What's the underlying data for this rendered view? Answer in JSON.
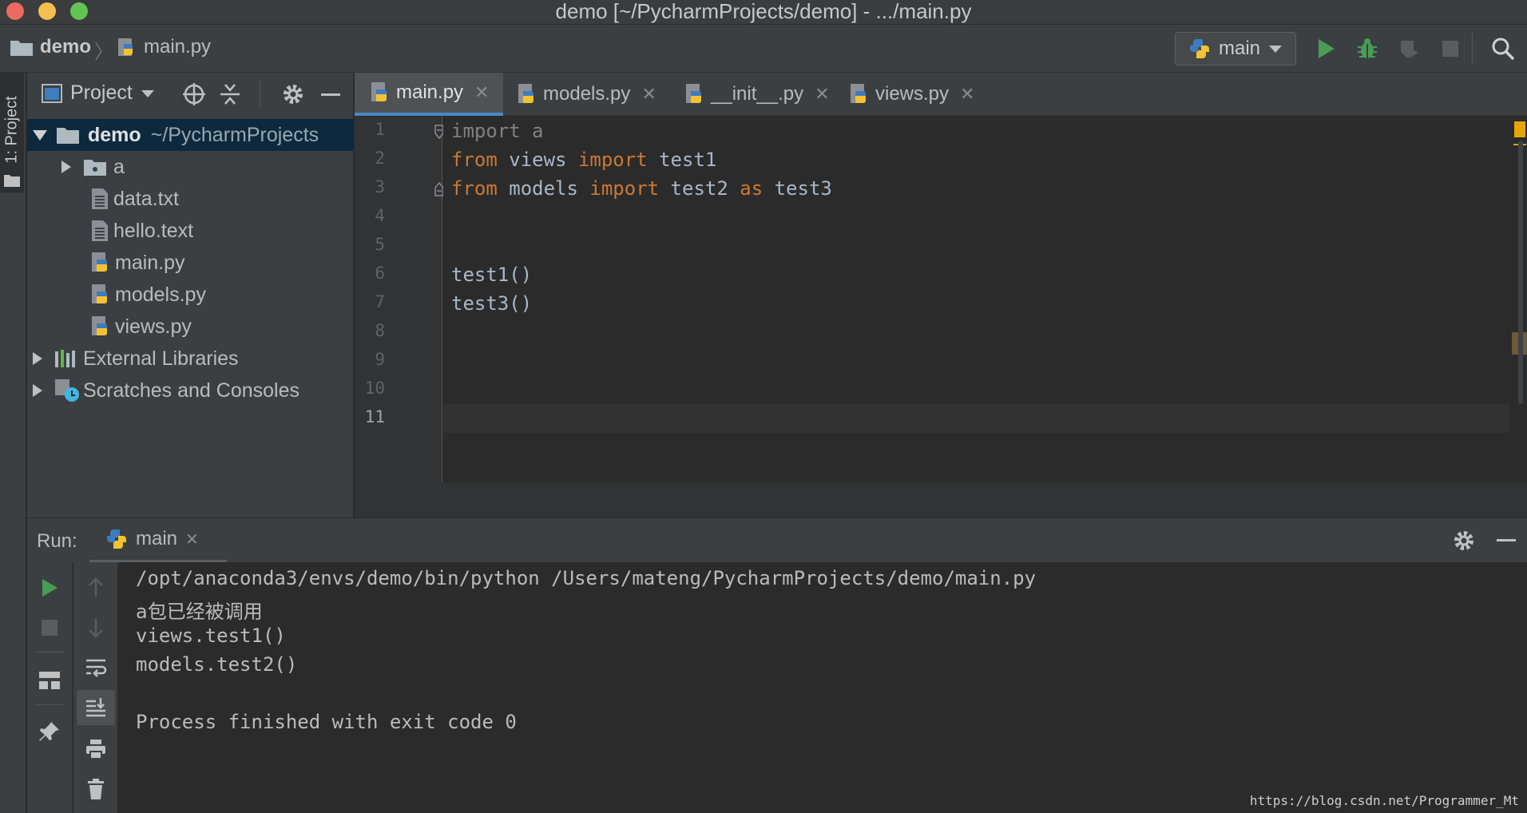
{
  "window": {
    "title": "demo [~/PycharmProjects/demo] - .../main.py"
  },
  "navbar": {
    "breadcrumb_project": "demo",
    "breadcrumb_file": "main.py",
    "run_config": "main"
  },
  "stripe": {
    "project_tab_label": "1: Project"
  },
  "project_panel": {
    "view_selector": "Project",
    "tree": [
      {
        "label": "demo",
        "hint": "~/PycharmProjects",
        "type": "folder-root"
      },
      {
        "label": "a",
        "type": "package"
      },
      {
        "label": "data.txt",
        "type": "text"
      },
      {
        "label": "hello.text",
        "type": "text"
      },
      {
        "label": "main.py",
        "type": "python"
      },
      {
        "label": "models.py",
        "type": "python"
      },
      {
        "label": "views.py",
        "type": "python"
      },
      {
        "label": "External Libraries",
        "type": "libraries"
      },
      {
        "label": "Scratches and Consoles",
        "type": "scratches"
      }
    ]
  },
  "editor": {
    "tabs": [
      {
        "label": "main.py",
        "active": true
      },
      {
        "label": "models.py"
      },
      {
        "label": "__init__.py"
      },
      {
        "label": "views.py"
      }
    ],
    "line_numbers": [
      "1",
      "2",
      "3",
      "4",
      "5",
      "6",
      "7",
      "8",
      "9",
      "10",
      "11"
    ],
    "code": {
      "l1_kw": "import",
      "l1_rest": " a",
      "l2_kw1": "from",
      "l2_mod": " views ",
      "l2_kw2": "import",
      "l2_name": " test1",
      "l3_kw1": "from",
      "l3_mod": " models ",
      "l3_kw2": "import",
      "l3_name": " test2 ",
      "l3_kw3": "as",
      "l3_alias": " test3",
      "l6": "test1()",
      "l7": "test3()"
    }
  },
  "run_panel": {
    "label": "Run:",
    "tab": "main",
    "output": [
      "/opt/anaconda3/envs/demo/bin/python /Users/mateng/PycharmProjects/demo/main.py",
      "a包已经被调用",
      "views.test1()",
      "models.test2()",
      "",
      "Process finished with exit code 0"
    ]
  },
  "watermark": "https://blog.csdn.net/Programmer_Mt",
  "colors": {
    "keyword": "#cc7832",
    "run_green": "#499c54",
    "selection": "#0d293e",
    "tab_underline": "#4a88c7"
  }
}
